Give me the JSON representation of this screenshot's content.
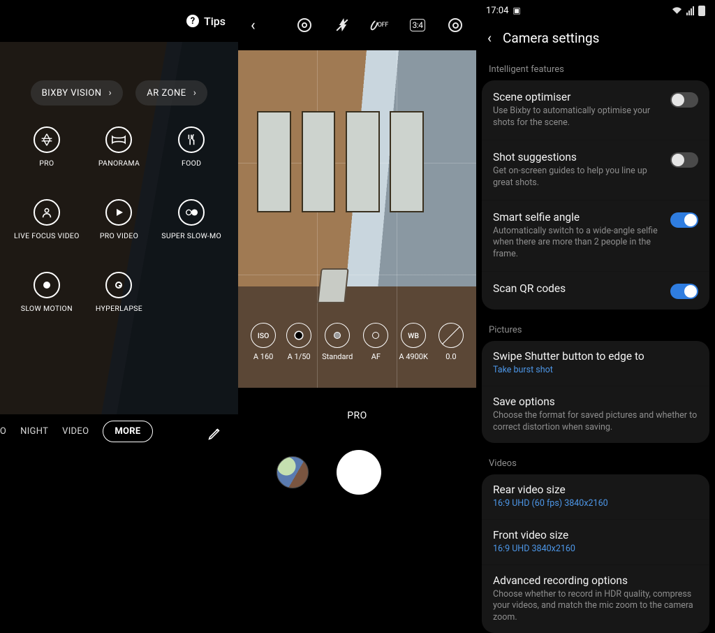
{
  "panel1": {
    "tips": "Tips",
    "bixby": "BIXBY VISION",
    "arzone": "AR ZONE",
    "modes": {
      "pro": "PRO",
      "panorama": "PANORAMA",
      "food": "FOOD",
      "live_focus_video": "LIVE FOCUS VIDEO",
      "pro_video": "PRO VIDEO",
      "super_slowmo": "SUPER SLOW-MO",
      "slow_motion": "SLOW MOTION",
      "hyperlapse": "HYPERLAPSE"
    },
    "tabs": {
      "to": "TO",
      "night": "NIGHT",
      "video": "VIDEO",
      "more": "MORE"
    }
  },
  "panel2": {
    "top": {
      "timer": "OFF",
      "ratio": "3:4"
    },
    "pro": {
      "iso_icon": "ISO",
      "iso": "A 160",
      "shutter": "A 1/50",
      "picture": "Standard",
      "focus": "AF",
      "wb_icon": "WB",
      "wb": "A 4900K",
      "ev": "0.0"
    },
    "mode": "PRO"
  },
  "panel3": {
    "status": {
      "time": "17:04"
    },
    "header": "Camera settings",
    "sections": {
      "intelligent": "Intelligent features",
      "pictures": "Pictures",
      "videos": "Videos"
    },
    "scene_opt": {
      "title": "Scene optimiser",
      "sub": "Use Bixby to automatically optimise your shots for the scene."
    },
    "shot_sugg": {
      "title": "Shot suggestions",
      "sub": "Get on-screen guides to help you line up great shots."
    },
    "smart_selfie": {
      "title": "Smart selfie angle",
      "sub": "Automatically switch to a wide-angle selfie when there are more than 2 people in the frame."
    },
    "qr": {
      "title": "Scan QR codes"
    },
    "swipe": {
      "title": "Swipe Shutter button to edge to",
      "sub": "Take burst shot"
    },
    "save": {
      "title": "Save options",
      "sub": "Choose the format for saved pictures and whether to correct distortion when saving."
    },
    "rear": {
      "title": "Rear video size",
      "sub": "16:9 UHD (60 fps) 3840x2160"
    },
    "front": {
      "title": "Front video size",
      "sub": "16:9 UHD 3840x2160"
    },
    "advanced": {
      "title": "Advanced recording options",
      "sub": "Choose whether to record in HDR quality, compress your videos, and match the mic zoom to the camera zoom."
    }
  }
}
